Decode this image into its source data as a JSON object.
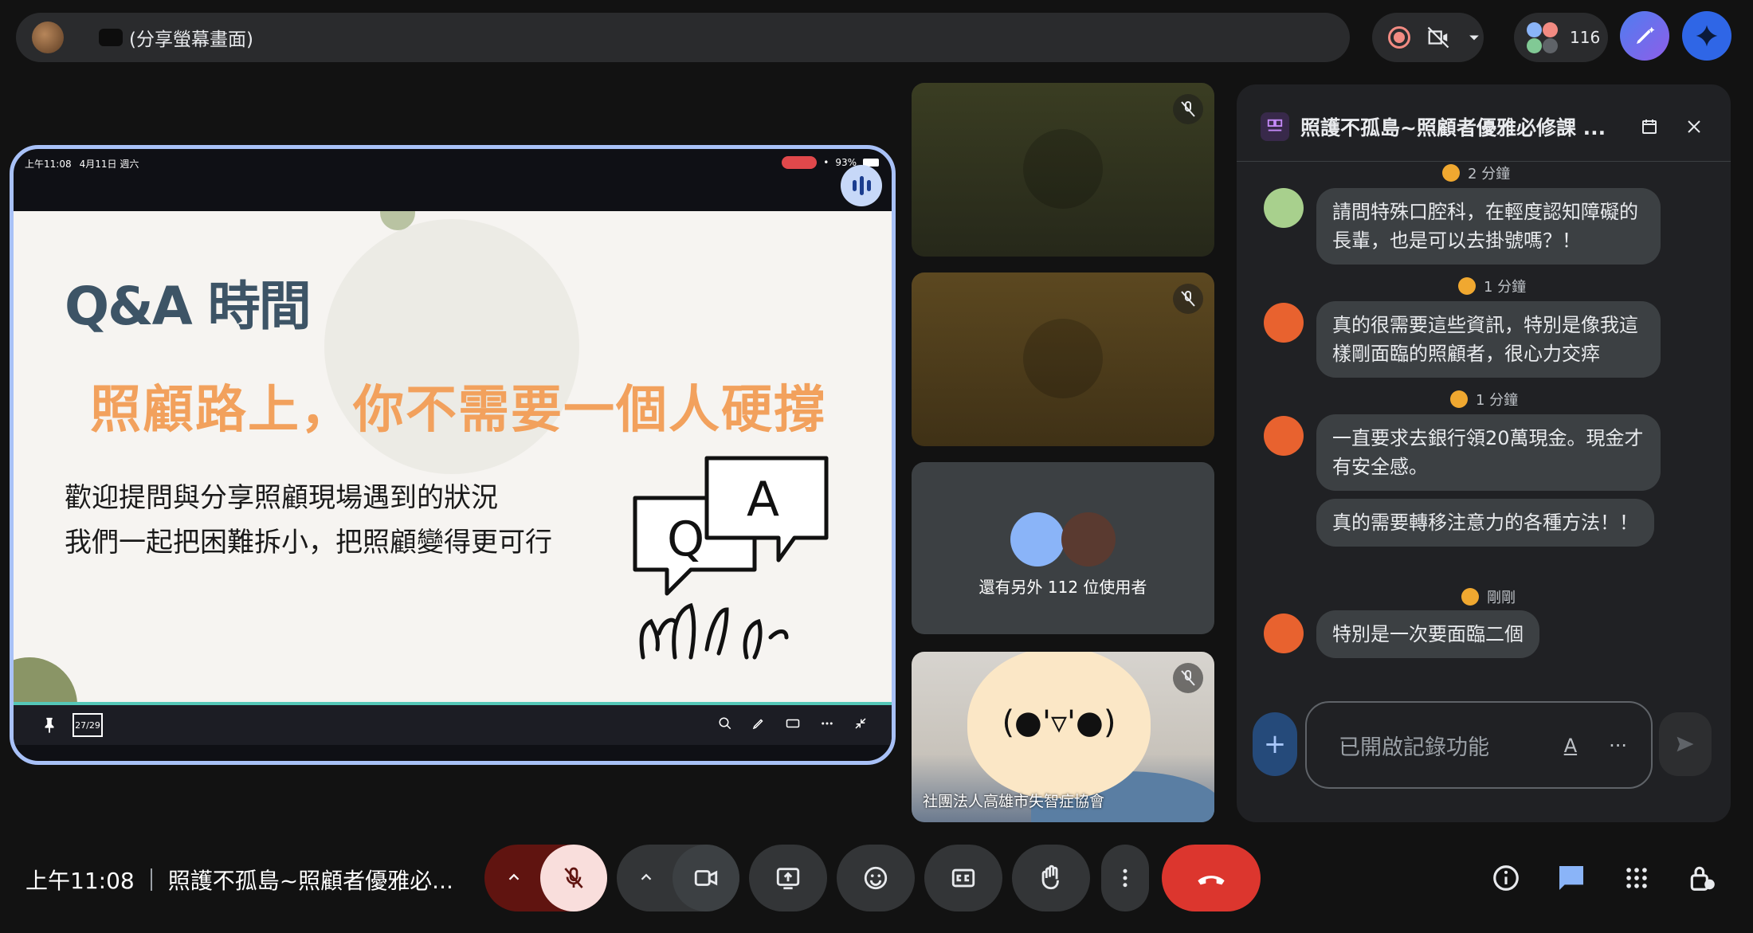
{
  "topbar": {
    "presenter_title": "(分享螢幕畫面)",
    "participant_count": "116"
  },
  "presentation": {
    "ipad_time": "上午11:08",
    "ipad_date": "4月11日 週六",
    "battery": "93%",
    "slide_title": "Q&A 時間",
    "slide_headline": "照顧路上，你不需要一個人硬撐",
    "slide_line1": "歡迎提問與分享照顧現場遇到的狀況",
    "slide_line2": "我們一起把困難拆小，把照顧變得更可行",
    "qa_q": "Q",
    "qa_a": "A",
    "page_indicator": "27/29"
  },
  "tiles": {
    "others_text": "還有另外 112 位使用者",
    "cam_emoticon": "(●'▿'●)",
    "cam_name": "社團法人高雄市失智症協會"
  },
  "chat": {
    "title": "照護不孤島~照顧者優雅必修課 ...",
    "messages": [
      {
        "time": "2 分鐘",
        "text": "請問特殊口腔科，在輕度認知障礙的長輩，也是可以去掛號嗎？！",
        "avatar_color": "#a8d08d"
      },
      {
        "time": "1 分鐘",
        "text": "真的很需要這些資訊，特別是像我這樣剛面臨的照顧者，很心力交瘁",
        "avatar_color": "#e8622f"
      },
      {
        "time": "1 分鐘",
        "text": "一直要求去銀行領20萬現金。現金才有安全感。",
        "text2": "真的需要轉移注意力的各種方法！！",
        "avatar_color": "#e8622f"
      },
      {
        "time": "剛剛",
        "text": "特別是一次要面臨二個",
        "avatar_color": "#e8622f"
      }
    ],
    "input_placeholder": "已開啟記錄功能",
    "format_label": "A",
    "more_label": "···"
  },
  "bottom": {
    "clock": "上午11:08",
    "meeting_title": "照護不孤島~照顧者優雅必..."
  },
  "colors": {
    "accent_blue": "#a8c7fa",
    "end_call": "#dc362e",
    "mic_off_bg": "#f9dedc",
    "slide_headline": "#f2a15d",
    "slide_title": "#3d5466"
  }
}
